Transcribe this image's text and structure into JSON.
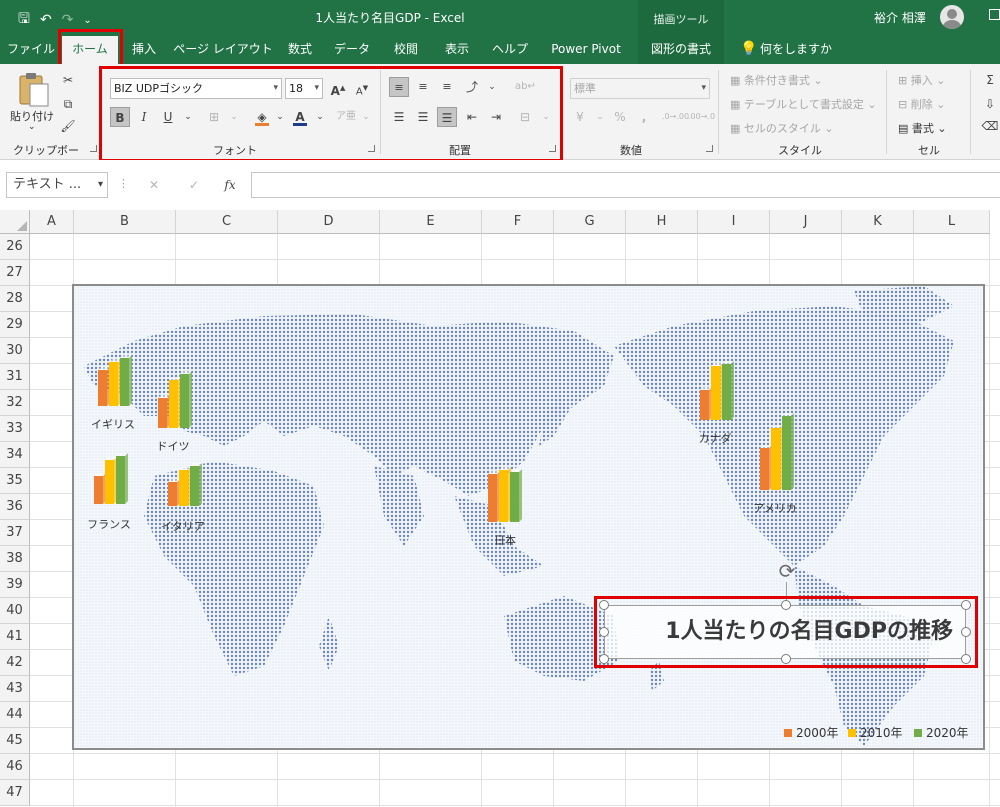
{
  "window": {
    "title": "1人当たり名目GDP - Excel",
    "context_tools": "描画ツール",
    "user": "裕介 相澤"
  },
  "tabs": [
    {
      "label": "ファイル"
    },
    {
      "label": "ホーム"
    },
    {
      "label": "挿入"
    },
    {
      "label": "ページ レイアウト"
    },
    {
      "label": "数式"
    },
    {
      "label": "データ"
    },
    {
      "label": "校閲"
    },
    {
      "label": "表示"
    },
    {
      "label": "ヘルプ"
    },
    {
      "label": "Power Pivot"
    },
    {
      "label": "図形の書式"
    },
    {
      "label": "何をしますか"
    }
  ],
  "ribbon": {
    "clipboard": {
      "paste": "貼り付け",
      "label": "クリップボード"
    },
    "font": {
      "name": "BIZ UDPゴシック",
      "size": "18",
      "bold": "B",
      "italic": "I",
      "underline": "U",
      "label": "フォント"
    },
    "align": {
      "label": "配置"
    },
    "number": {
      "format": "標準",
      "percent": "%",
      "comma": ",",
      "label": "数値"
    },
    "styles": {
      "conditional": "条件付き書式",
      "table": "テーブルとして書式設定",
      "cell": "セルのスタイル",
      "label": "スタイル"
    },
    "cells": {
      "insert": "挿入",
      "delete": "削除",
      "format": "書式",
      "label": "セル"
    }
  },
  "formula_bar": {
    "name_box": "テキスト ...",
    "fx": "fx",
    "value": ""
  },
  "columns": [
    "A",
    "B",
    "C",
    "D",
    "E",
    "F",
    "G",
    "H",
    "I",
    "J",
    "K",
    "L"
  ],
  "rows": [
    "26",
    "27",
    "28",
    "29",
    "30",
    "31",
    "32",
    "33",
    "34",
    "35",
    "36",
    "37",
    "38",
    "39",
    "40",
    "41",
    "42",
    "43",
    "44",
    "45",
    "46",
    "47"
  ],
  "chart": {
    "title": "1人当たりの名目GDPの推移",
    "countries": [
      "イギリス",
      "ドイツ",
      "フランス",
      "イタリア",
      "日本",
      "カナダ",
      "アメリカ"
    ],
    "legend": [
      "2000年",
      "2010年",
      "2020年"
    ],
    "colors": {
      "s2000": "#ed7d31",
      "s2010": "#ffc000",
      "s2020": "#70ad47"
    }
  }
}
